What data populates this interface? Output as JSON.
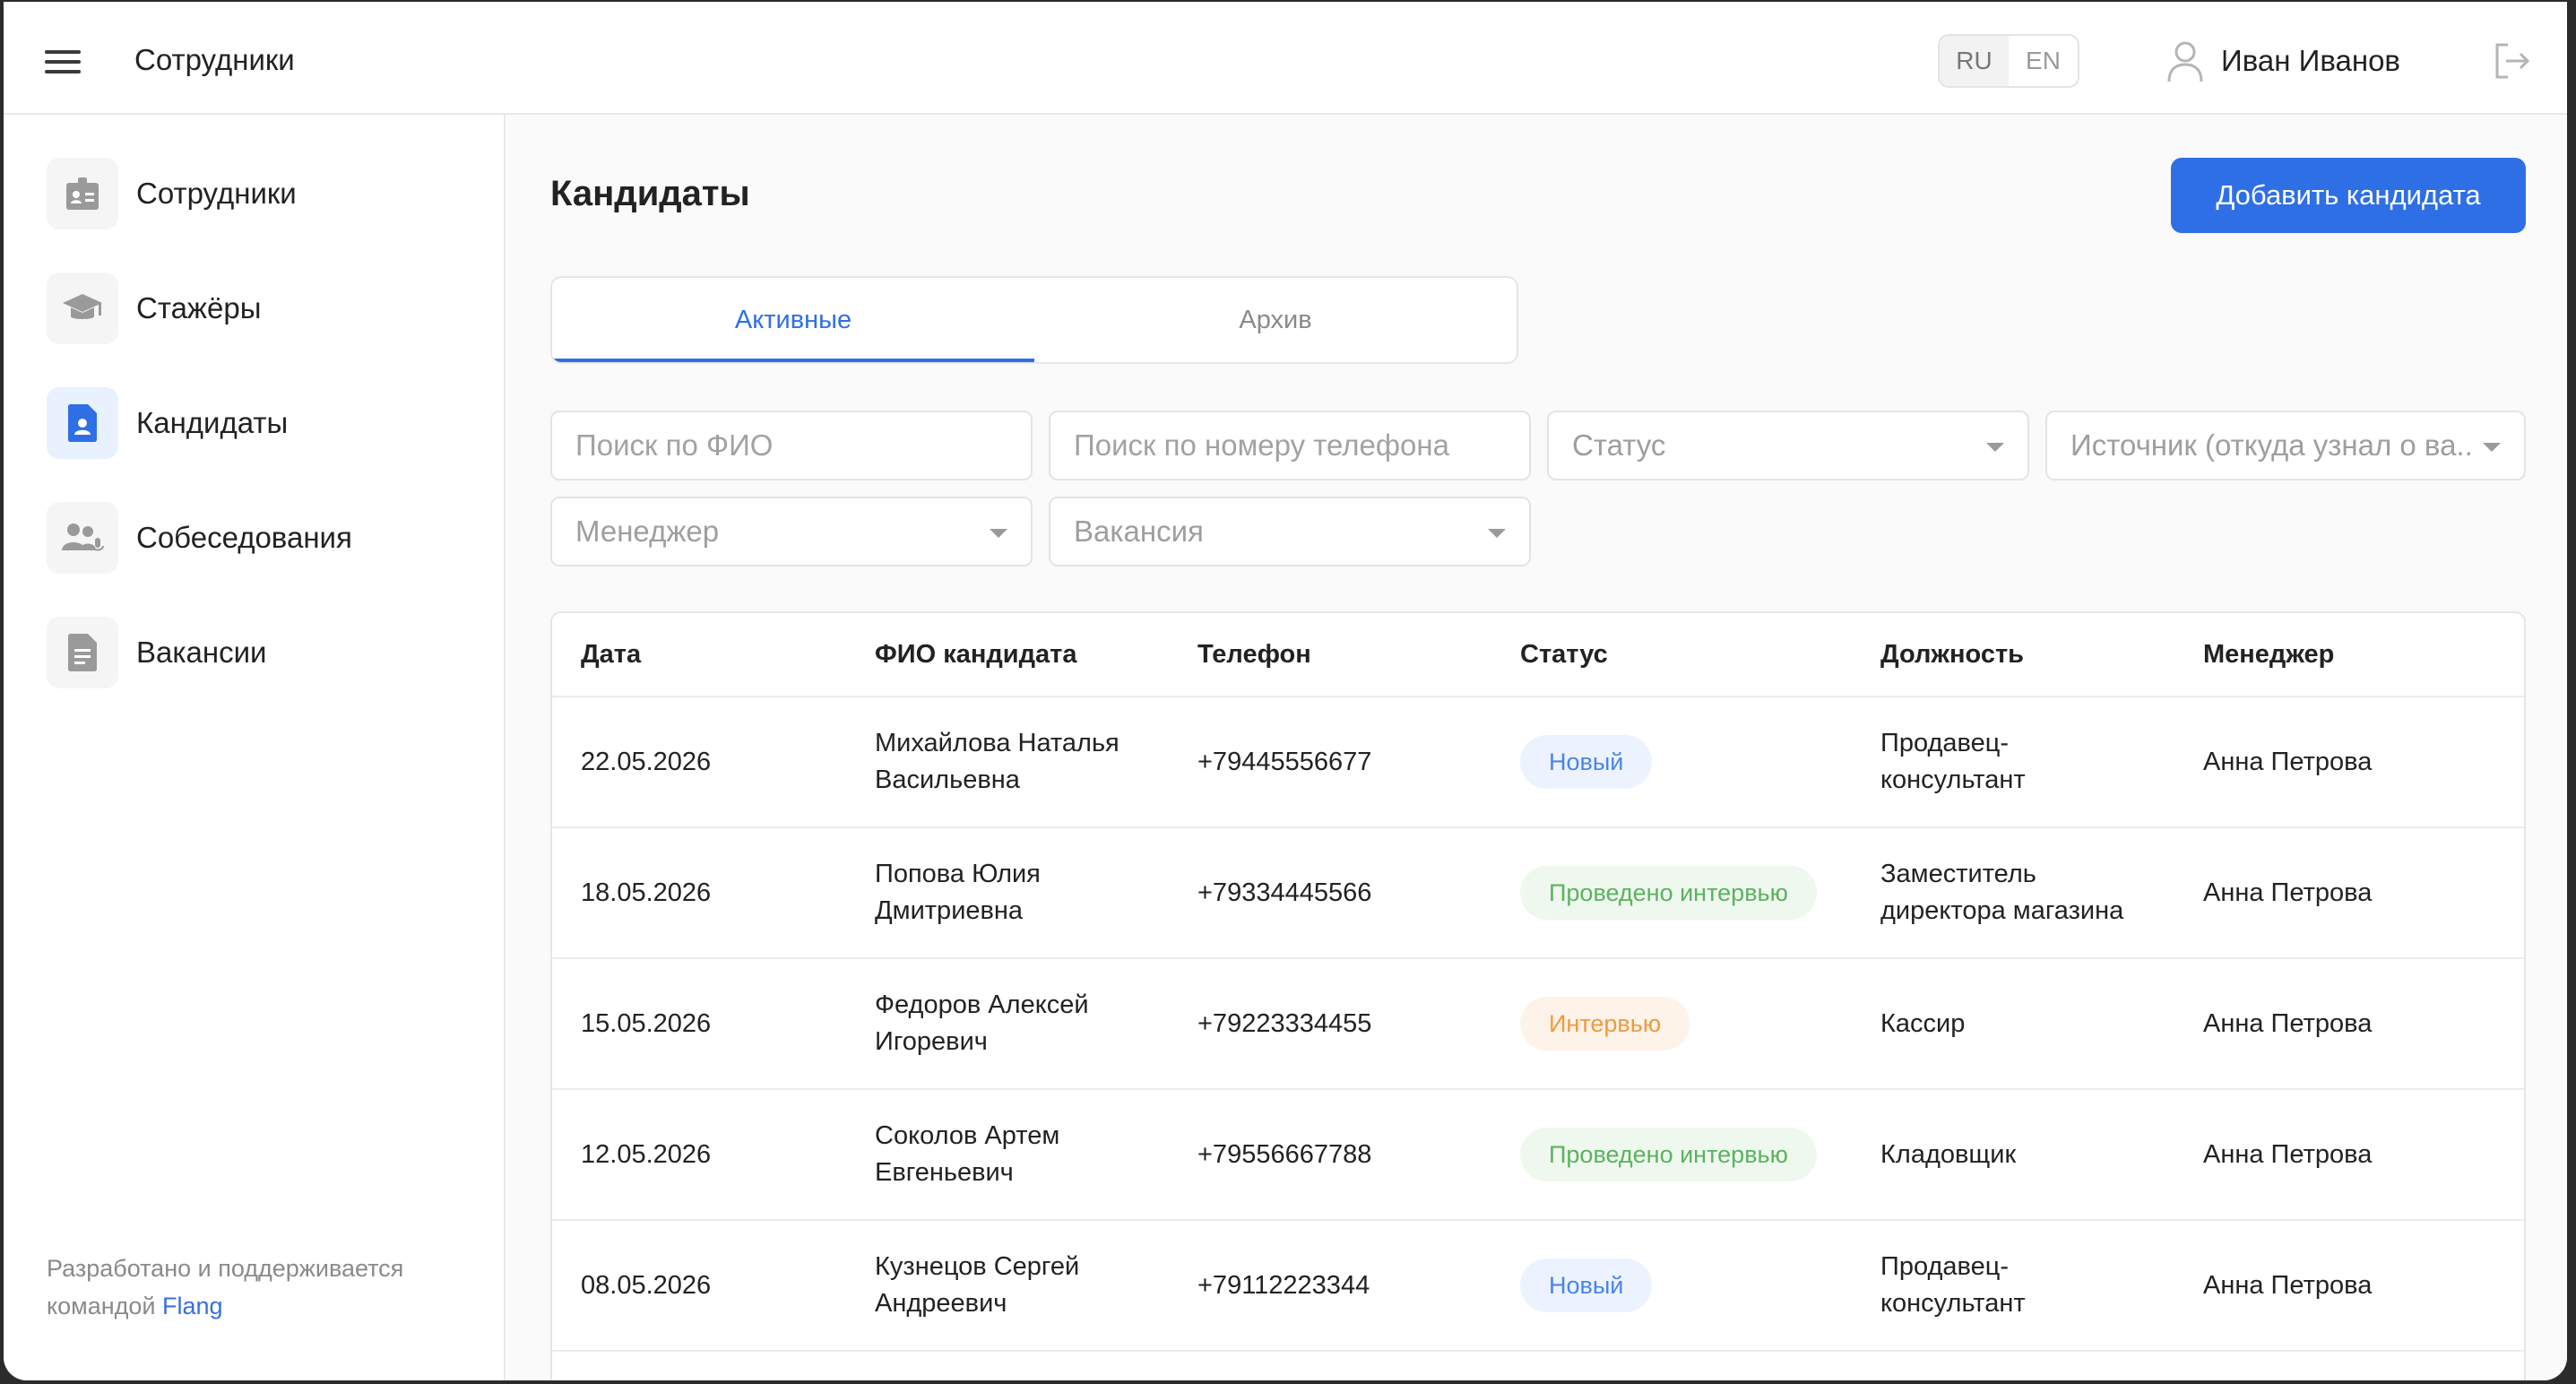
{
  "header": {
    "app_title": "Сотрудники",
    "lang_ru": "RU",
    "lang_en": "EN",
    "user_name": "Иван Иванов"
  },
  "sidebar": {
    "items": [
      {
        "label": "Сотрудники",
        "icon": "id-badge-icon"
      },
      {
        "label": "Стажёры",
        "icon": "graduation-cap-icon"
      },
      {
        "label": "Кандидаты",
        "icon": "document-user-icon"
      },
      {
        "label": "Собеседования",
        "icon": "users-interview-icon"
      },
      {
        "label": "Вакансии",
        "icon": "document-icon"
      }
    ],
    "active_index": 2,
    "footer_text": "Разработано и поддерживается командой",
    "footer_link": "Flang"
  },
  "main": {
    "title": "Кандидаты",
    "add_button": "Добавить кандидата",
    "tabs": [
      {
        "label": "Активные"
      },
      {
        "label": "Архив"
      }
    ],
    "filters": {
      "search_name": "Поиск по ФИО",
      "search_phone": "Поиск по номеру телефона",
      "status": "Статус",
      "source": "Источник (откуда узнал о ва...",
      "manager": "Менеджер",
      "vacancy": "Вакансия"
    }
  },
  "table": {
    "columns": [
      "Дата",
      "ФИО кандидата",
      "Телефон",
      "Статус",
      "Должность",
      "Менеджер"
    ],
    "rows": [
      {
        "date": "22.05.2026",
        "name_line1": "Михайлова Наталья",
        "name_line2": "Васильевна",
        "phone": "+79445556677",
        "status": "Новый",
        "position_line1": "Продавец-",
        "position_line2": "консультант",
        "manager": "Анна Петрова"
      },
      {
        "date": "18.05.2026",
        "name_line1": "Попова Юлия",
        "name_line2": "Дмитриевна",
        "phone": "+79334445566",
        "status": "Проведено интервью",
        "position_line1": "Заместитель",
        "position_line2": "директора магазина",
        "manager": "Анна Петрова"
      },
      {
        "date": "15.05.2026",
        "name_line1": "Федоров Алексей",
        "name_line2": "Игоревич",
        "phone": "+79223334455",
        "status": "Интервью",
        "position_line1": "Кассир",
        "position_line2": "",
        "manager": "Анна Петрова"
      },
      {
        "date": "12.05.2026",
        "name_line1": "Соколов Артем",
        "name_line2": "Евгеньевич",
        "phone": "+79556667788",
        "status": "Проведено интервью",
        "position_line1": "Кладовщик",
        "position_line2": "",
        "manager": "Анна Петрова"
      },
      {
        "date": "08.05.2026",
        "name_line1": "Кузнецов Сергей",
        "name_line2": "Андреевич",
        "phone": "+79112223344",
        "status": "Новый",
        "position_line1": "Продавец-",
        "position_line2": "консультант",
        "manager": "Анна Петрова"
      }
    ]
  },
  "colors": {
    "accent": "#2f6fe6",
    "status_new_bg": "#ecf3fe",
    "status_new_text": "#4a84ea",
    "status_done_bg": "#eef8ee",
    "status_done_text": "#5bb25e",
    "status_interview_bg": "#fdf3e8",
    "status_interview_text": "#ef9a3e"
  }
}
